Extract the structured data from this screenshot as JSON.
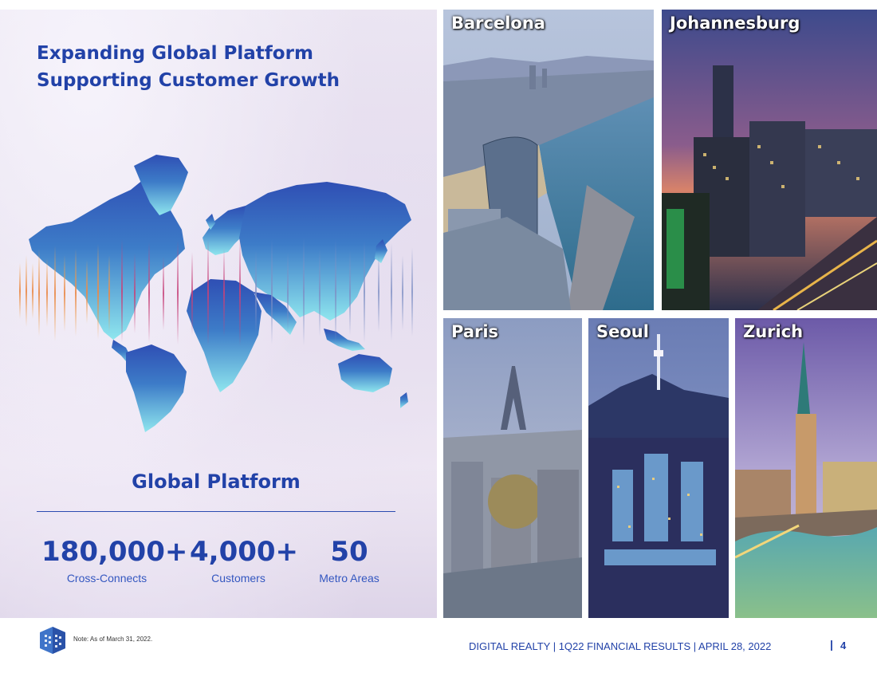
{
  "slide": {
    "title_line1": "Expanding Global Platform",
    "title_line2": "Supporting Customer Growth"
  },
  "platform": {
    "heading": "Global Platform",
    "stats": [
      {
        "value": "180,000+",
        "label": "Cross-Connects"
      },
      {
        "value": "4,000+",
        "label": "Customers"
      },
      {
        "value": "50",
        "label": "Metro Areas"
      }
    ]
  },
  "cities": [
    {
      "name": "Barcelona"
    },
    {
      "name": "Johannesburg"
    },
    {
      "name": "Paris"
    },
    {
      "name": "Seoul"
    },
    {
      "name": "Zurich"
    }
  ],
  "footer": {
    "note": "Note: As of March 31, 2022.",
    "meta": "DIGITAL REALTY | 1Q22 FINANCIAL RESULTS | APRIL 28, 2022",
    "separator": "|",
    "page": "4"
  },
  "colors": {
    "brand_blue": "#2242a8",
    "map_top": "#2f4fb4",
    "map_bottom": "#8fe6ee"
  }
}
